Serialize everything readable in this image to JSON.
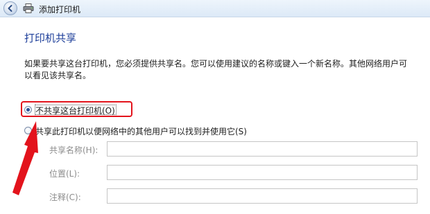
{
  "window": {
    "title": "添加打印机"
  },
  "icons": {
    "back": "back-arrow-icon",
    "printer": "printer-icon"
  },
  "colors": {
    "accent": "#1e3f9a",
    "highlight": "#e3131c"
  },
  "section": {
    "title": "打印机共享",
    "description": "如果要共享这台打印机，您必须提供共享名。您可以使用建议的名称或键入一个新名称。其他网络用户可以看见该共享名。"
  },
  "options": [
    {
      "label": "不共享这台打印机(O)",
      "selected": true
    },
    {
      "label": "共享此打印机以便网络中的其他用户可以找到并使用它(S)",
      "selected": false
    }
  ],
  "fields": {
    "share_name": {
      "label": "共享名称(H):",
      "value": ""
    },
    "location": {
      "label": "位置(L):",
      "value": ""
    },
    "comment": {
      "label": "注释(C):",
      "value": ""
    }
  }
}
